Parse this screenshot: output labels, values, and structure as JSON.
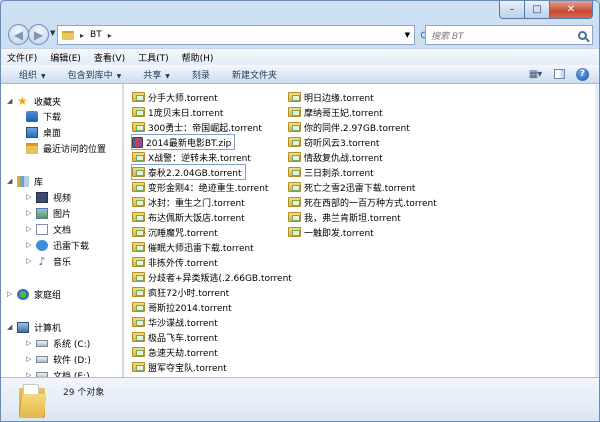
{
  "window": {
    "min_label": "–",
    "max_label": "□",
    "close_label": "✕"
  },
  "address": {
    "path": "BT",
    "search_placeholder": "搜索 BT"
  },
  "menu": [
    "文件(F)",
    "编辑(E)",
    "查看(V)",
    "工具(T)",
    "帮助(H)"
  ],
  "toolbar": {
    "organize": "组织",
    "include": "包含到库中",
    "share": "共享",
    "burn": "刻录",
    "new_folder": "新建文件夹"
  },
  "nav": {
    "favorites": "收藏夹",
    "downloads": "下载",
    "desktop": "桌面",
    "recent": "最近访问的位置",
    "libraries": "库",
    "videos": "视频",
    "pictures": "图片",
    "documents": "文档",
    "thunder": "迅雷下载",
    "music": "音乐",
    "homegroup": "家庭组",
    "computer": "计算机",
    "drive_c": "系统 (C:)",
    "drive_d": "软件 (D:)",
    "drive_e": "文档 (E:)"
  },
  "files_col1": [
    "分手大师.torrent",
    "1庞贝末日.torrent",
    "300勇士：帝国崛起.torrent",
    "2014最新电影BT.zip",
    "X战警：逆转未来.torrent",
    "泰秋2.2.04GB.torrent",
    "变形金刚4：绝迹重生.torrent",
    "冰封：重生之门.torrent",
    "布达佩斯大饭店.torrent",
    "沉睡魔咒.torrent",
    "催眠大师迅雷下载.torrent",
    "非拣外传.torrent",
    "分歧者+异类叛逃(.2.66GB.torrent",
    "疯狂72小时.torrent",
    "哥斯拉2014.torrent",
    "华沙谍战.torrent",
    "极品飞车.torrent",
    "急速天劫.torrent",
    "盟军夺宝队.torrent"
  ],
  "files_col2": [
    "明日边缘.torrent",
    "摩纳哥王妃.torrent",
    "你的同伴.2.97GB.torrent",
    "窃听风云3.torrent",
    "情敌复仇战.torrent",
    "三日刺杀.torrent",
    "死亡之雪2迅雷下载.torrent",
    "死在西部的一百万种方式.torrent",
    "我，弗兰肯斯坦.torrent",
    "一触即发.torrent"
  ],
  "details": {
    "count": "29 个对象"
  }
}
